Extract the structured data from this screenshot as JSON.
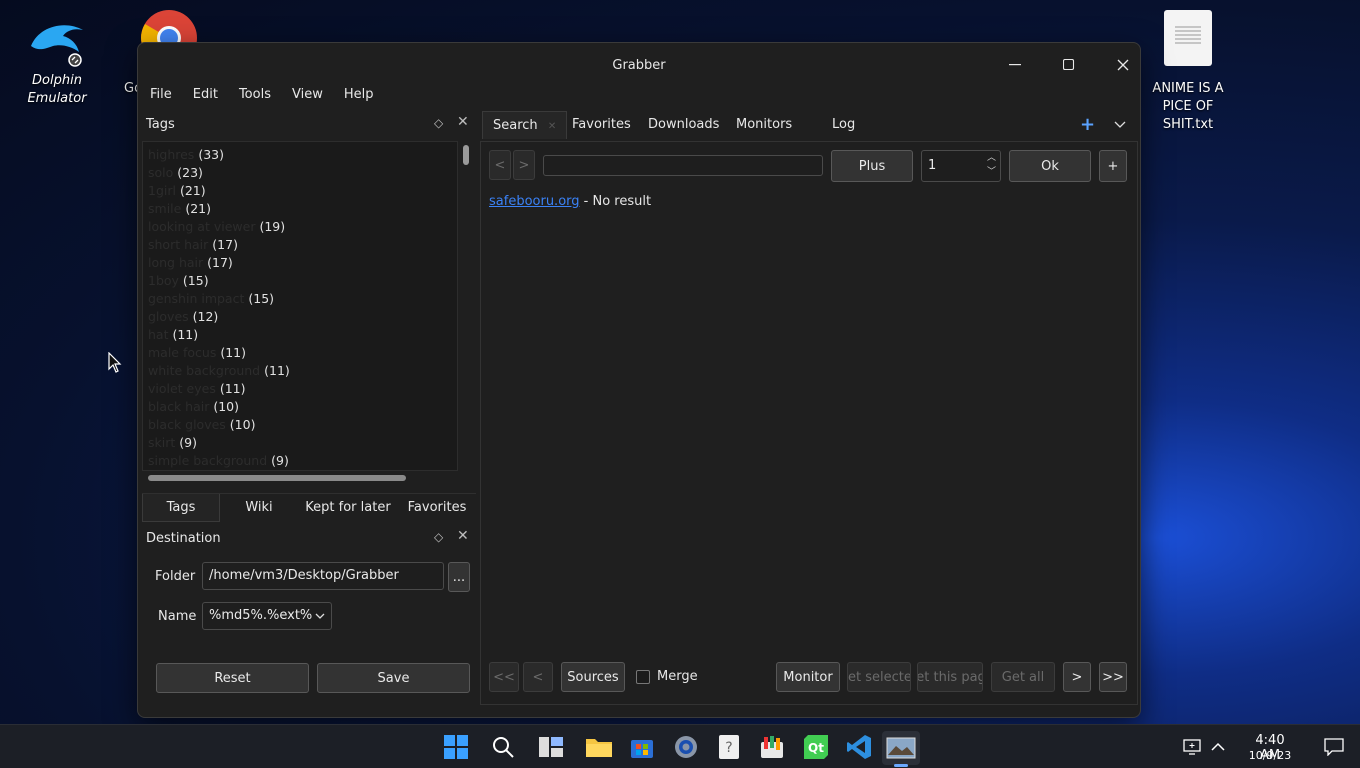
{
  "desktop": {
    "icons": [
      {
        "label": "Dolphin Emulator"
      },
      {
        "label": "Go"
      },
      {
        "label": "ANIME IS A PICE OF SHIT.txt"
      }
    ]
  },
  "window": {
    "title": "Grabber",
    "menu": [
      "File",
      "Edit",
      "Tools",
      "View",
      "Help"
    ],
    "tags_panel": {
      "title": "Tags",
      "tags": [
        {
          "name": "highres",
          "count": "(33)"
        },
        {
          "name": "solo",
          "count": "(23)"
        },
        {
          "name": "1girl",
          "count": "(21)"
        },
        {
          "name": "smile",
          "count": "(21)"
        },
        {
          "name": "looking at viewer",
          "count": "(19)"
        },
        {
          "name": "short hair",
          "count": "(17)"
        },
        {
          "name": "long hair",
          "count": "(17)"
        },
        {
          "name": "1boy",
          "count": "(15)"
        },
        {
          "name": "genshin impact",
          "count": "(15)"
        },
        {
          "name": "gloves",
          "count": "(12)"
        },
        {
          "name": "hat",
          "count": "(11)"
        },
        {
          "name": "male focus",
          "count": "(11)"
        },
        {
          "name": "white background",
          "count": "(11)"
        },
        {
          "name": "violet eyes",
          "count": "(11)"
        },
        {
          "name": "black hair",
          "count": "(10)"
        },
        {
          "name": "black gloves",
          "count": "(10)"
        },
        {
          "name": "skirt",
          "count": "(9)"
        },
        {
          "name": "simple background",
          "count": "(9)"
        }
      ]
    },
    "left_tabs": [
      "Tags",
      "Wiki",
      "Kept for later",
      "Favorites"
    ],
    "destination": {
      "title": "Destination",
      "folder_label": "Folder",
      "folder_value": "/home/vm3/Desktop/Grabber",
      "browse_label": "...",
      "name_label": "Name",
      "name_value": "%md5%.%ext%",
      "reset_label": "Reset",
      "save_label": "Save"
    },
    "main_tabs": [
      "Search",
      "Favorites",
      "Downloads",
      "Monitors",
      "Log"
    ],
    "search": {
      "prev_label": "<",
      "next_label": ">",
      "query": "",
      "plus_label": "Plus",
      "page": "1",
      "ok_label": "Ok",
      "add_label": "+",
      "result_site": "safebooru.org",
      "result_text": " - No result"
    },
    "bottom_bar": {
      "first_label": "<<",
      "prev_label": "<",
      "sources_label": "Sources",
      "merge_label": "Merge",
      "monitor_label": "Monitor",
      "get_selected_label": "Get selected",
      "get_page_label": "Get this page",
      "get_all_label": "Get all",
      "next_label": ">",
      "last_label": ">>"
    }
  },
  "taskbar": {
    "time": "4:40 AM",
    "date": "10/9/23"
  }
}
